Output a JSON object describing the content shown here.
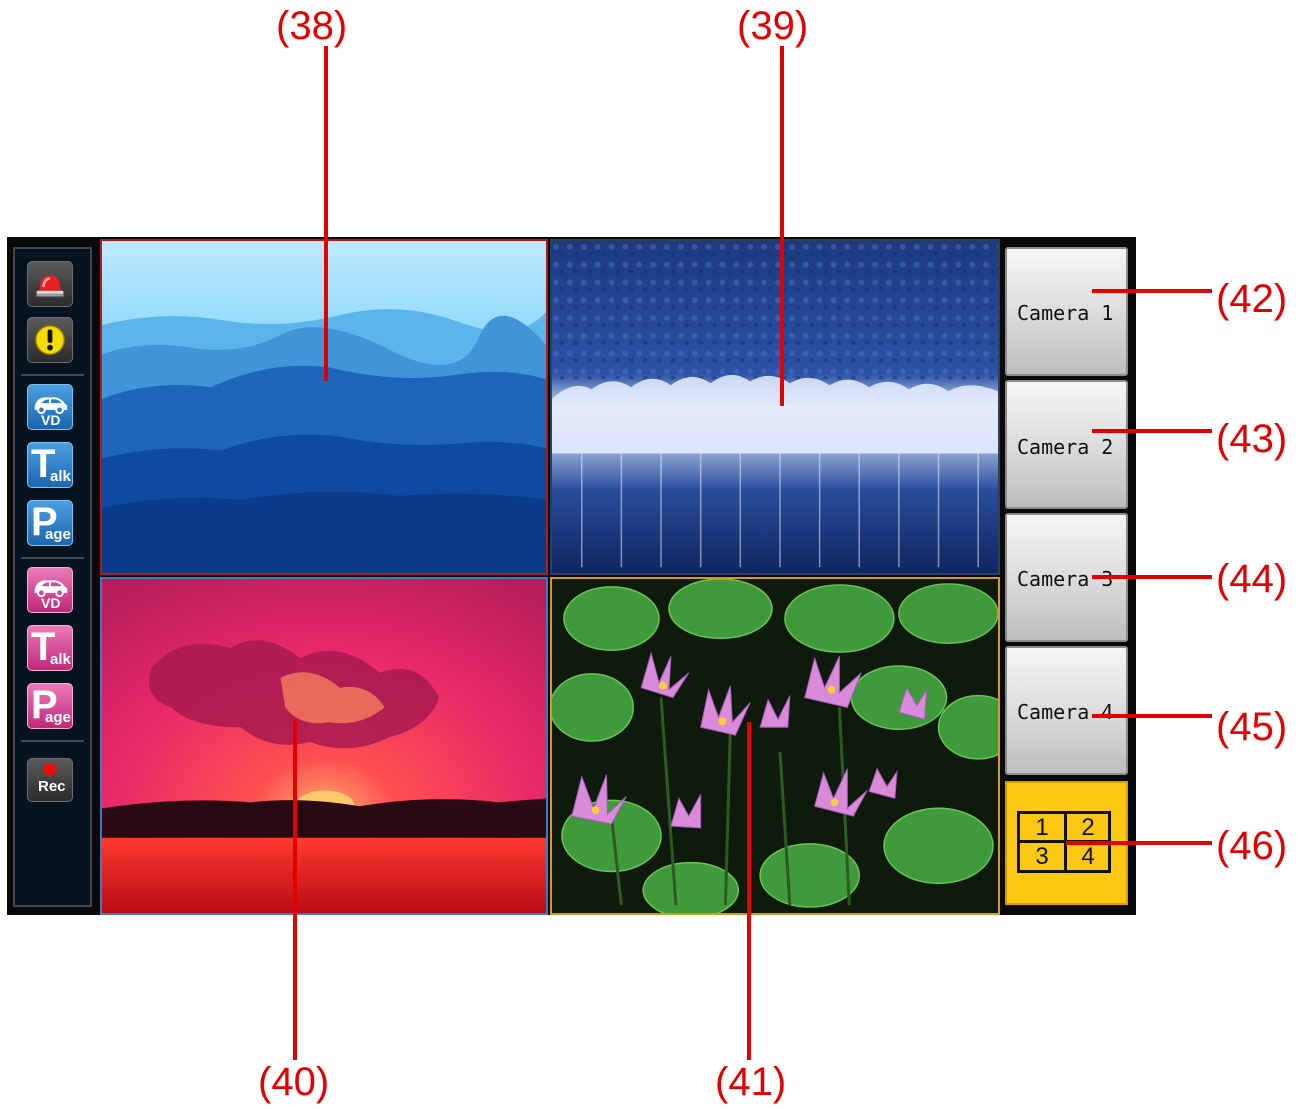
{
  "callouts": {
    "c38": "(38)",
    "c39": "(39)",
    "c40": "(40)",
    "c41": "(41)",
    "c42": "(42)",
    "c43": "(43)",
    "c44": "(44)",
    "c45": "(45)",
    "c46": "(46)"
  },
  "toolbar": {
    "alarm_icon": "alarm-light-icon",
    "warning_icon": "exclamation-icon",
    "vd_blue": "VD",
    "talk_blue_initial": "T",
    "talk_blue_rest": "alk",
    "page_blue_initial": "P",
    "page_blue_rest": "age",
    "vd_pink": "VD",
    "talk_pink_initial": "T",
    "talk_pink_rest": "alk",
    "page_pink_initial": "P",
    "page_pink_rest": "age",
    "rec": "Rec"
  },
  "cameras": {
    "camera_1": "Camera 1",
    "camera_2": "Camera 2",
    "camera_3": "Camera 3",
    "camera_4": "Camera 4"
  },
  "quad_view": {
    "cell_1": "1",
    "cell_2": "2",
    "cell_3": "3",
    "cell_4": "4"
  },
  "colors": {
    "callout": "#e30000",
    "tile_1_border": "#b01c1c",
    "tile_3_border": "#3a7bc4",
    "tile_4_border": "#d69a1c",
    "quad_button": "#fbc914",
    "blue_button": "#2a80cc",
    "pink_button": "#d8449a"
  }
}
